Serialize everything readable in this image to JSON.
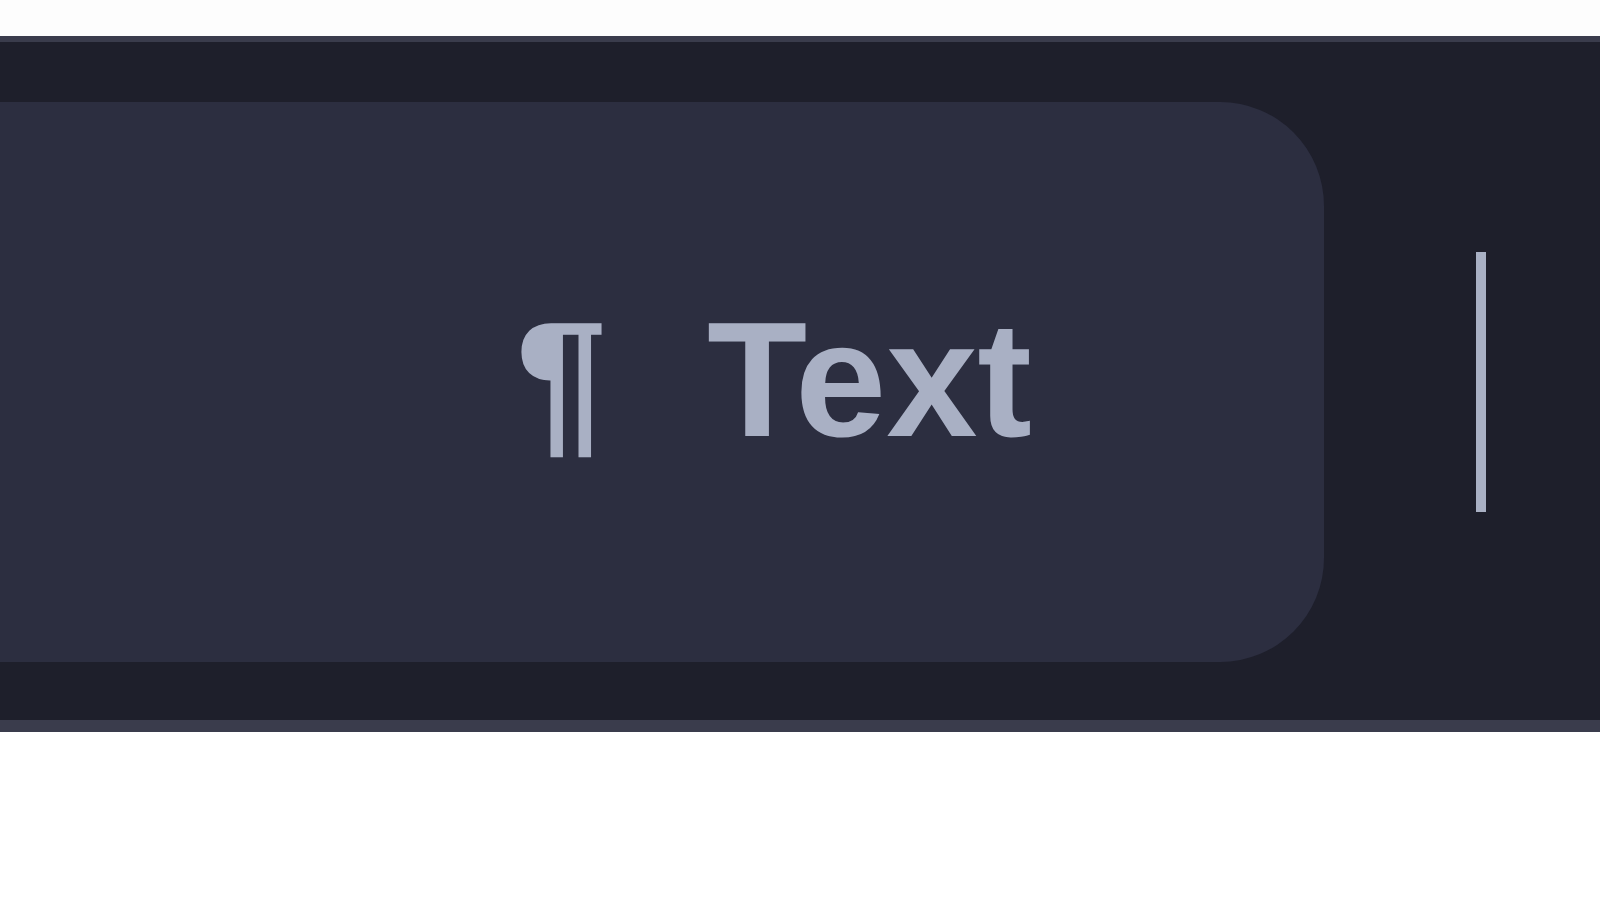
{
  "toolbar": {
    "button": {
      "icon": "¶",
      "label": "Text"
    }
  }
}
